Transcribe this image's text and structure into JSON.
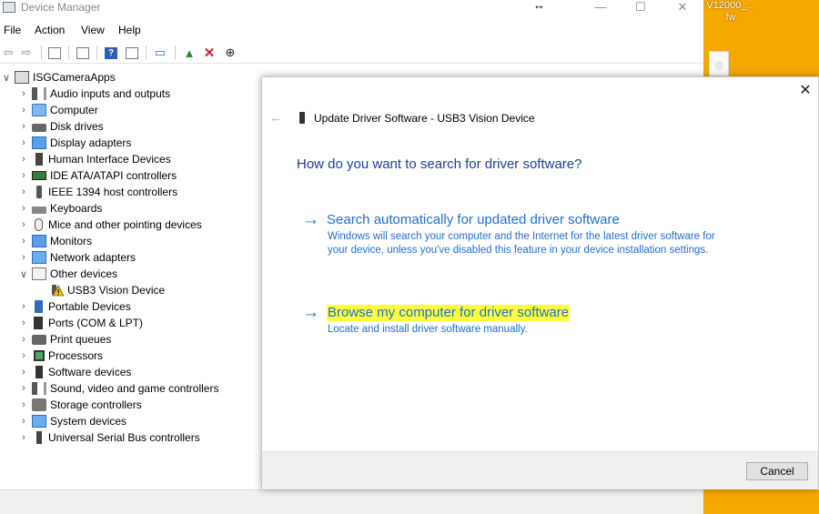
{
  "desktop": {
    "icon_label_line1": "V12000_...",
    "icon_label_line2": "fw"
  },
  "window": {
    "title": "Device Manager",
    "minimize": "—",
    "maximize": "☐",
    "close": "✕"
  },
  "menu": [
    "File",
    "Action",
    "View",
    "Help"
  ],
  "tree": {
    "root": "ISGCameraApps",
    "items": [
      "Audio inputs and outputs",
      "Computer",
      "Disk drives",
      "Display adapters",
      "Human Interface Devices",
      "IDE ATA/ATAPI controllers",
      "IEEE 1394 host controllers",
      "Keyboards",
      "Mice and other pointing devices",
      "Monitors",
      "Network adapters",
      "Other devices",
      "USB3 Vision Device",
      "Portable Devices",
      "Ports (COM & LPT)",
      "Print queues",
      "Processors",
      "Software devices",
      "Sound, video and game controllers",
      "Storage controllers",
      "System devices",
      "Universal Serial Bus controllers"
    ]
  },
  "dialog": {
    "title": "Update Driver Software - USB3 Vision Device",
    "heading": "How do you want to search for driver software?",
    "option1_title": "Search automatically for updated driver software",
    "option1_desc": "Windows will search your computer and the Internet for the latest driver software for your device, unless you've disabled this feature in your device installation settings.",
    "option2_title": "Browse my computer for driver software",
    "option2_desc": "Locate and install driver software manually.",
    "cancel_label": "Cancel",
    "highlight_color": "#ffff3c",
    "link_color": "#1e6fcf"
  },
  "icons": {
    "back": "←",
    "option_arrow": "→",
    "close": "✕",
    "chevron_right": "›",
    "chevron_down": "∨"
  }
}
